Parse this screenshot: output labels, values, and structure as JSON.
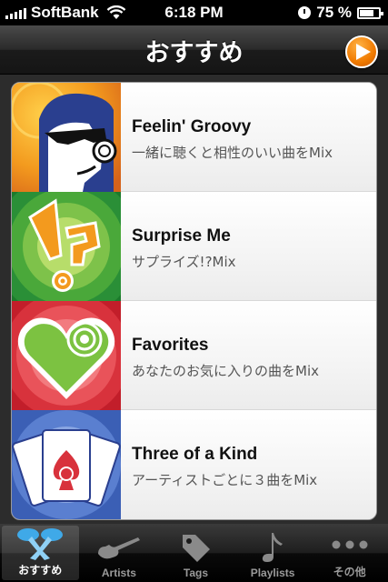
{
  "status_bar": {
    "carrier": "SoftBank",
    "time": "6:18 PM",
    "battery_percent": "75 %",
    "battery_level": 0.75
  },
  "nav": {
    "title": "おすすめ"
  },
  "list": {
    "items": [
      {
        "title": "Feelin' Groovy",
        "subtitle": "一緒に聴くと相性のいい曲をMix",
        "icon": "groovy-face-icon"
      },
      {
        "title": "Surprise Me",
        "subtitle": "サプライズ!?Mix",
        "icon": "exclamation-question-icon"
      },
      {
        "title": "Favorites",
        "subtitle": "あなたのお気に入りの曲をMix",
        "icon": "heart-icon"
      },
      {
        "title": "Three of a Kind",
        "subtitle": "アーティストごとに３曲をMix",
        "icon": "playing-cards-icon"
      }
    ]
  },
  "tabs": [
    {
      "label": "おすすめ",
      "icon": "featured-icon",
      "active": true
    },
    {
      "label": "Artists",
      "icon": "guitar-icon",
      "active": false
    },
    {
      "label": "Tags",
      "icon": "tag-icon",
      "active": false
    },
    {
      "label": "Playlists",
      "icon": "music-note-icon",
      "active": false
    },
    {
      "label": "その他",
      "icon": "more-icon",
      "active": false
    }
  ],
  "colors": {
    "accent_orange": "#f07a00",
    "nav_dark": "#1b1b1b"
  }
}
